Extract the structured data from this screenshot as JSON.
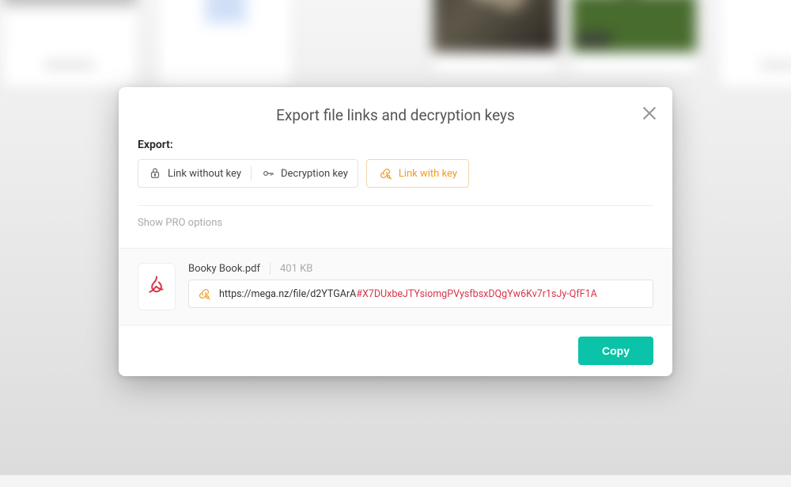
{
  "dialog": {
    "title": "Export file links and decryption keys",
    "export_label": "Export:",
    "option_link_without_key": "Link without key",
    "option_decryption_key": "Decryption key",
    "option_link_with_key": "Link with key",
    "pro_options_label": "Show PRO options",
    "copy_button": "Copy"
  },
  "file": {
    "name": "Booky Book.pdf",
    "size": "401 KB",
    "link_base": "https://mega.nz/file/d2YTGArA",
    "link_key": "#X7DUxbeJTYsiomgPVysfbsxDQgYw6Kv7r1sJy-QfF1A"
  },
  "icons": {
    "close": "close-icon",
    "lock": "lock-icon",
    "key": "key-icon",
    "link_key": "link-with-key-icon",
    "pdf": "pdf-icon"
  },
  "colors": {
    "accent_orange": "#f29a1f",
    "accent_teal": "#0ac3a8",
    "key_red": "#d6354a"
  }
}
